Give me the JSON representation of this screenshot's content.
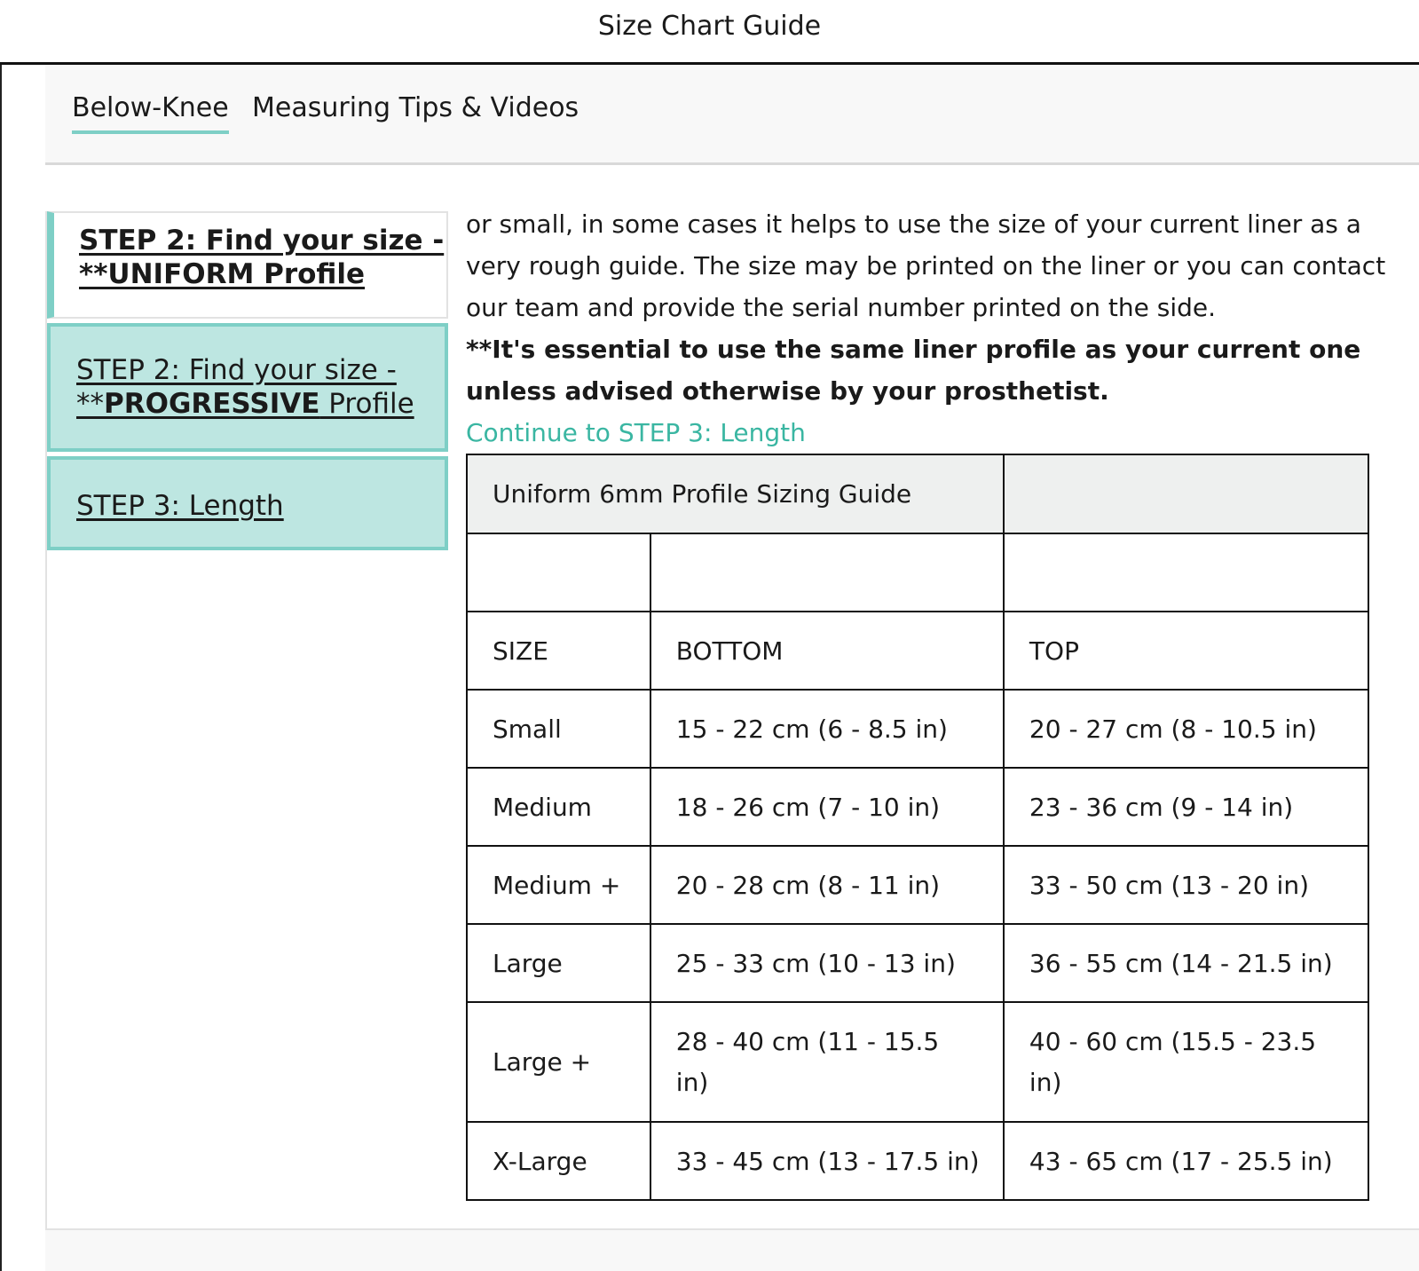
{
  "window": {
    "title": "Size Chart Guide"
  },
  "tabs": [
    {
      "label": "Below-Knee",
      "active": true
    },
    {
      "label": "Measuring Tips & Videos",
      "active": false
    }
  ],
  "steps": [
    {
      "label": "STEP 2: Find your size - **UNIFORM Profile"
    },
    {
      "label_prefix": "STEP 2: Find your size - **",
      "label_bold": "PROGRESSIVE",
      "label_suffix": " Profile"
    },
    {
      "label": "STEP 3: Length"
    }
  ],
  "content": {
    "paragraph": "or small, in some cases it helps to use the size of your current liner as a very rough guide. The size may be printed on the liner or you can contact our team and provide the serial number printed on the side.",
    "emphasis": "**It's essential to use the same liner profile as your current one unless advised otherwise by your prosthetist.",
    "continue_link": "Continue to STEP 3: Length"
  },
  "table": {
    "caption": "Uniform 6mm Profile Sizing Guide",
    "headers": [
      "SIZE",
      "BOTTOM",
      "TOP"
    ],
    "rows": [
      [
        "Small",
        "15 - 22 cm (6 - 8.5 in)",
        "20 - 27 cm (8 - 10.5 in)"
      ],
      [
        "Medium",
        "18 - 26 cm (7 - 10 in)",
        "23 - 36 cm (9 - 14 in)"
      ],
      [
        "Medium +",
        "20 - 28 cm (8 - 11 in)",
        "33 - 50 cm (13 - 20 in)"
      ],
      [
        "Large",
        "25 - 33 cm (10 - 13 in)",
        "36 - 55 cm (14 - 21.5 in)"
      ],
      [
        "Large +",
        "28 - 40 cm (11 - 15.5 in)",
        "40 - 60 cm (15.5 - 23.5 in)"
      ],
      [
        "X-Large",
        "33 - 45 cm (13 - 17.5 in)",
        "43 - 65 cm (17 - 25.5 in)"
      ]
    ]
  },
  "colors": {
    "accent": "#7ecfc6",
    "accent_fill": "#bde6e1",
    "link": "#3ab6a2",
    "caption_bg": "#eef0ef"
  }
}
